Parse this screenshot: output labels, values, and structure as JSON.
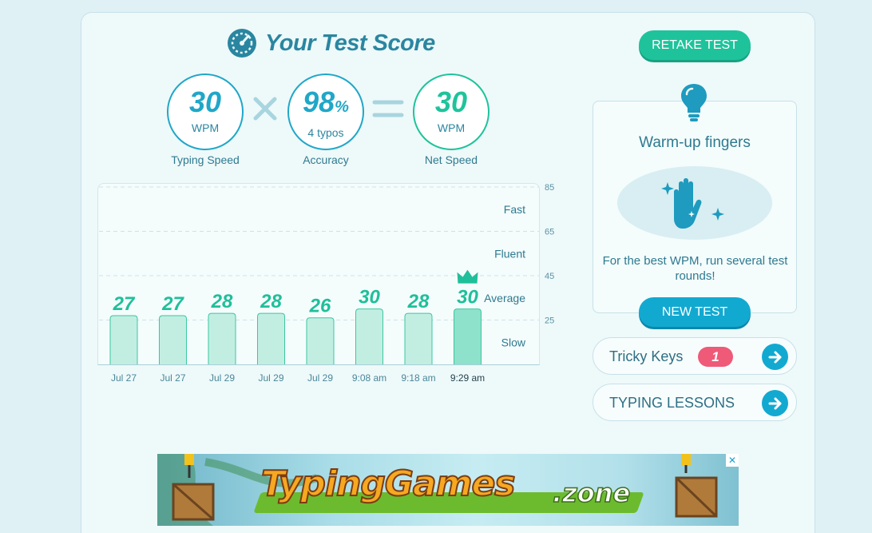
{
  "header": {
    "title": "Your Test Score",
    "retake_label": "RETAKE TEST"
  },
  "scores": {
    "typing_speed": {
      "value": "30",
      "unit": "WPM",
      "label": "Typing Speed"
    },
    "accuracy": {
      "value": "98",
      "suffix": "%",
      "sub": "4 typos",
      "label": "Accuracy"
    },
    "net_speed": {
      "value": "30",
      "unit": "WPM",
      "label": "Net Speed"
    }
  },
  "chart_data": {
    "type": "bar",
    "categories": [
      "Jul 27",
      "Jul 27",
      "Jul 29",
      "Jul 29",
      "Jul 29",
      "9:08 am",
      "9:18 am",
      "9:29 am"
    ],
    "values": [
      27,
      27,
      28,
      28,
      26,
      30,
      28,
      30
    ],
    "ylim": [
      5,
      85
    ],
    "yticks": [
      85,
      65,
      45,
      25
    ],
    "bands": [
      "Fast",
      "Fluent",
      "Average",
      "Slow"
    ],
    "highlight_index": 7,
    "grid": true,
    "colors": {
      "bar": "#c2eee2",
      "bar_highlight": "#8ee2cb",
      "bar_stroke": "#3cc7a2",
      "label": "#1fbf9a"
    }
  },
  "tip": {
    "title": "Warm-up fingers",
    "text": "For the best WPM, run several test rounds!",
    "button_label": "NEW TEST"
  },
  "tricky_keys": {
    "label": "Tricky Keys",
    "count": "1"
  },
  "lessons": {
    "label": "TYPING LESSONS"
  },
  "ad": {
    "brand": "TypingGames",
    "suffix": ".zone",
    "close": "✕"
  },
  "colors": {
    "teal": "#20a7c8",
    "green": "#1fc39b",
    "pink": "#ee5a78"
  }
}
